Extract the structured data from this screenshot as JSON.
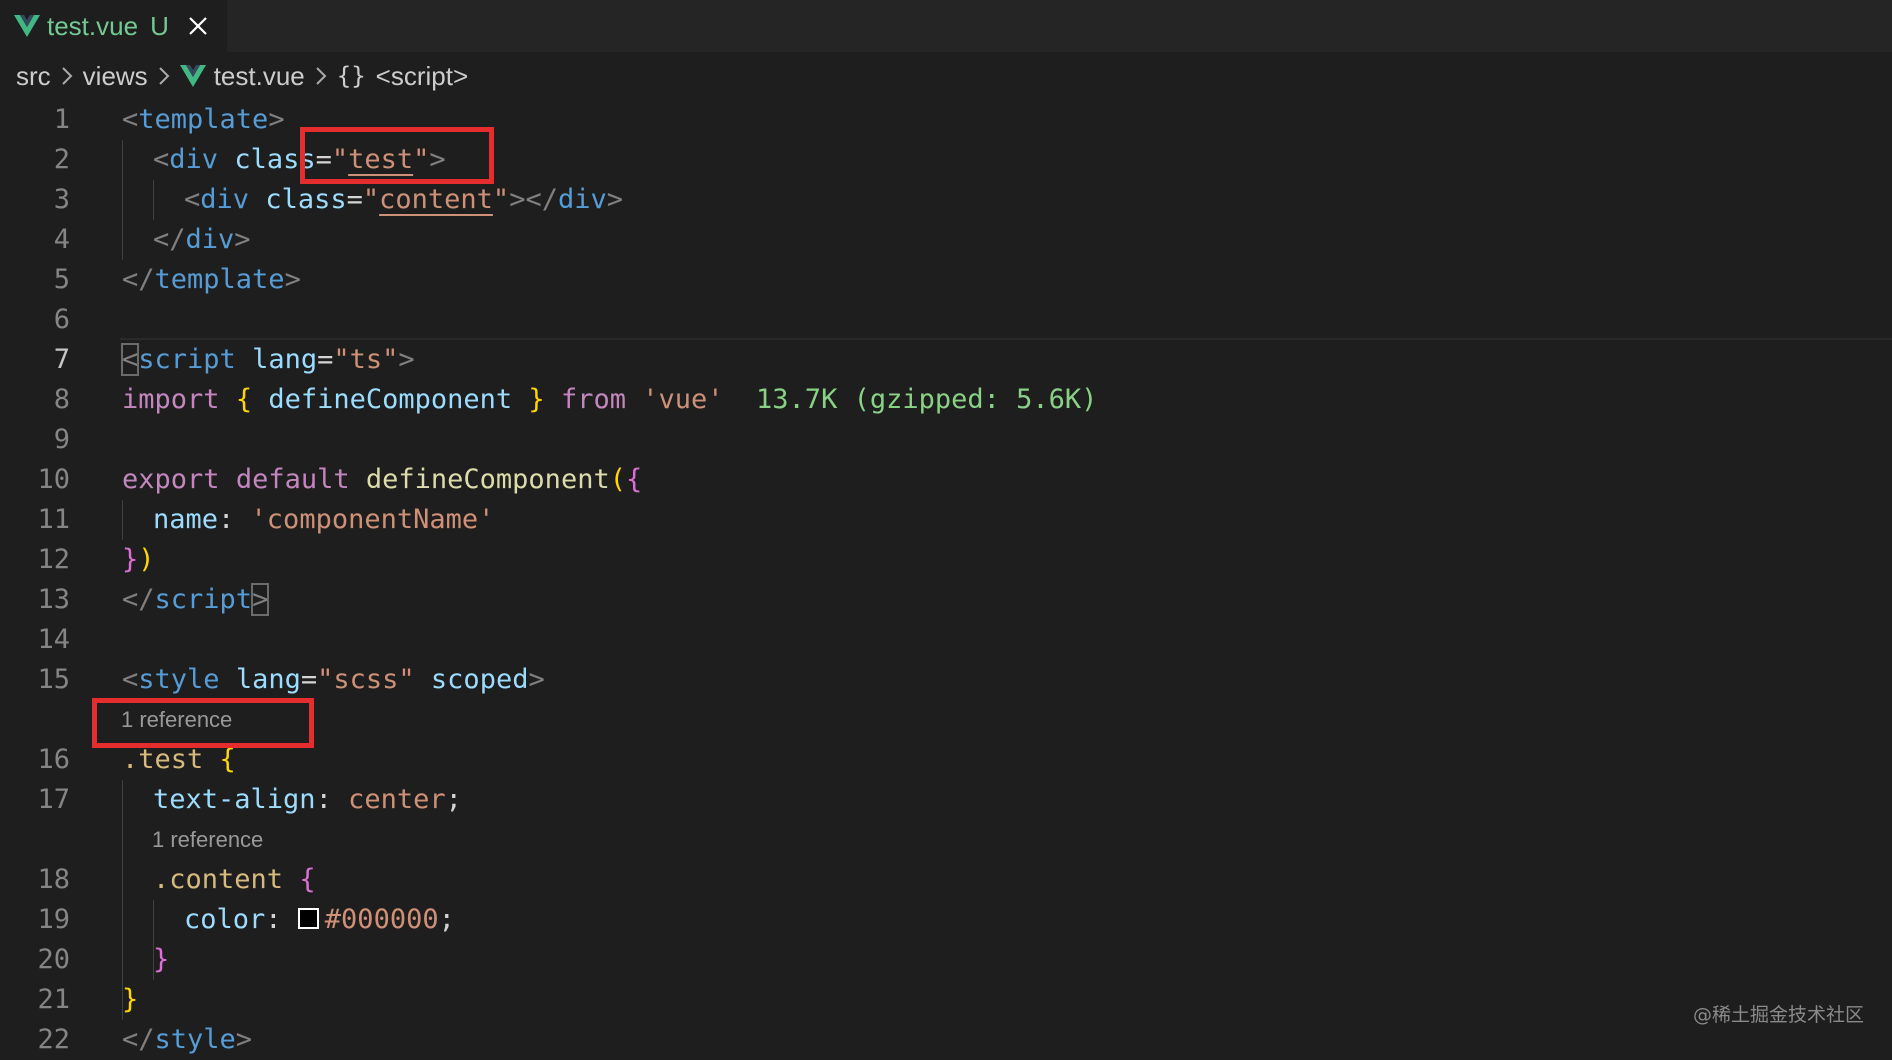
{
  "tab": {
    "file_name": "test.vue",
    "status": "U"
  },
  "breadcrumb": {
    "items": [
      "src",
      "views",
      "test.vue",
      "<script>"
    ],
    "symbol": "{}"
  },
  "editor": {
    "active_line": 7,
    "line_numbers": [
      "1",
      "2",
      "3",
      "4",
      "5",
      "6",
      "7",
      "8",
      "9",
      "10",
      "11",
      "12",
      "13",
      "14",
      "15",
      "16",
      "17",
      "18",
      "19",
      "20",
      "21",
      "22"
    ],
    "codelens": [
      "1 reference",
      "1 reference"
    ],
    "lines": [
      {
        "indent": 0,
        "tokens": [
          {
            "t": "<",
            "c": "t-punct"
          },
          {
            "t": "template",
            "c": "t-tag"
          },
          {
            "t": ">",
            "c": "t-punct"
          }
        ]
      },
      {
        "indent": 1,
        "tokens": [
          {
            "t": "<",
            "c": "t-punct"
          },
          {
            "t": "div",
            "c": "t-tag"
          },
          {
            "t": " ",
            "c": "t-plain"
          },
          {
            "t": "class",
            "c": "t-attr"
          },
          {
            "t": "=",
            "c": "t-plain"
          },
          {
            "t": "\"",
            "c": "t-str"
          },
          {
            "t": "test",
            "c": "t-str u-squig"
          },
          {
            "t": "\"",
            "c": "t-str"
          },
          {
            "t": ">",
            "c": "t-punct"
          }
        ]
      },
      {
        "indent": 2,
        "tokens": [
          {
            "t": "<",
            "c": "t-punct"
          },
          {
            "t": "div",
            "c": "t-tag"
          },
          {
            "t": " ",
            "c": "t-plain"
          },
          {
            "t": "class",
            "c": "t-attr"
          },
          {
            "t": "=",
            "c": "t-plain"
          },
          {
            "t": "\"",
            "c": "t-str"
          },
          {
            "t": "content",
            "c": "t-str u-squig"
          },
          {
            "t": "\"",
            "c": "t-str"
          },
          {
            "t": "></",
            "c": "t-punct"
          },
          {
            "t": "div",
            "c": "t-tag"
          },
          {
            "t": ">",
            "c": "t-punct"
          }
        ]
      },
      {
        "indent": 1,
        "tokens": [
          {
            "t": "</",
            "c": "t-punct"
          },
          {
            "t": "div",
            "c": "t-tag"
          },
          {
            "t": ">",
            "c": "t-punct"
          }
        ]
      },
      {
        "indent": 0,
        "tokens": [
          {
            "t": "</",
            "c": "t-punct"
          },
          {
            "t": "template",
            "c": "t-tag"
          },
          {
            "t": ">",
            "c": "t-punct"
          }
        ]
      },
      {
        "indent": 0,
        "tokens": []
      },
      {
        "indent": 0,
        "tokens": [
          {
            "t": "<",
            "c": "t-punct bracket-match"
          },
          {
            "t": "script",
            "c": "t-tag"
          },
          {
            "t": " ",
            "c": "t-plain"
          },
          {
            "t": "lang",
            "c": "t-attr"
          },
          {
            "t": "=",
            "c": "t-plain"
          },
          {
            "t": "\"ts\"",
            "c": "t-str"
          },
          {
            "t": ">",
            "c": "t-punct"
          }
        ]
      },
      {
        "indent": 0,
        "tokens": [
          {
            "t": "import",
            "c": "t-kw"
          },
          {
            "t": " ",
            "c": "t-plain"
          },
          {
            "t": "{",
            "c": "t-b1"
          },
          {
            "t": " defineComponent ",
            "c": "t-var"
          },
          {
            "t": "}",
            "c": "t-b1"
          },
          {
            "t": " ",
            "c": "t-plain"
          },
          {
            "t": "from",
            "c": "t-kw"
          },
          {
            "t": " ",
            "c": "t-plain"
          },
          {
            "t": "'vue'",
            "c": "t-str"
          },
          {
            "t": "  13.7K (gzipped: 5.6K)",
            "c": "t-hint"
          }
        ]
      },
      {
        "indent": 0,
        "tokens": []
      },
      {
        "indent": 0,
        "tokens": [
          {
            "t": "export",
            "c": "t-kw"
          },
          {
            "t": " ",
            "c": "t-plain"
          },
          {
            "t": "default",
            "c": "t-kw"
          },
          {
            "t": " ",
            "c": "t-plain"
          },
          {
            "t": "defineComponent",
            "c": "t-fn"
          },
          {
            "t": "(",
            "c": "t-b1"
          },
          {
            "t": "{",
            "c": "t-b2"
          }
        ]
      },
      {
        "indent": 1,
        "tokens": [
          {
            "t": "name",
            "c": "t-var"
          },
          {
            "t": ": ",
            "c": "t-plain"
          },
          {
            "t": "'componentName'",
            "c": "t-str"
          }
        ]
      },
      {
        "indent": 0,
        "tokens": [
          {
            "t": "}",
            "c": "t-b2"
          },
          {
            "t": ")",
            "c": "t-b1"
          }
        ]
      },
      {
        "indent": 0,
        "tokens": [
          {
            "t": "</",
            "c": "t-punct"
          },
          {
            "t": "script",
            "c": "t-tag"
          },
          {
            "t": ">",
            "c": "t-punct bracket-match"
          }
        ]
      },
      {
        "indent": 0,
        "tokens": []
      },
      {
        "indent": 0,
        "tokens": [
          {
            "t": "<",
            "c": "t-punct"
          },
          {
            "t": "style",
            "c": "t-tag"
          },
          {
            "t": " ",
            "c": "t-plain"
          },
          {
            "t": "lang",
            "c": "t-attr"
          },
          {
            "t": "=",
            "c": "t-plain"
          },
          {
            "t": "\"scss\"",
            "c": "t-str"
          },
          {
            "t": " ",
            "c": "t-plain"
          },
          {
            "t": "scoped",
            "c": "t-attr"
          },
          {
            "t": ">",
            "c": "t-punct"
          }
        ]
      },
      {
        "indent": 0,
        "tokens": [
          {
            "t": ".test",
            "c": "t-sel"
          },
          {
            "t": " ",
            "c": "t-plain"
          },
          {
            "t": "{",
            "c": "t-b1"
          }
        ]
      },
      {
        "indent": 1,
        "tokens": [
          {
            "t": "text-align",
            "c": "t-var"
          },
          {
            "t": ": ",
            "c": "t-plain"
          },
          {
            "t": "center",
            "c": "t-str"
          },
          {
            "t": ";",
            "c": "t-plain"
          }
        ]
      },
      {
        "indent": 1,
        "tokens": [
          {
            "t": ".content",
            "c": "t-sel"
          },
          {
            "t": " ",
            "c": "t-plain"
          },
          {
            "t": "{",
            "c": "t-b2"
          }
        ]
      },
      {
        "indent": 2,
        "tokens": [
          {
            "t": "color",
            "c": "t-var"
          },
          {
            "t": ": ",
            "c": "t-plain"
          },
          {
            "swatch": "#000000"
          },
          {
            "t": "#000000",
            "c": "t-str"
          },
          {
            "t": ";",
            "c": "t-plain"
          }
        ]
      },
      {
        "indent": 1,
        "tokens": [
          {
            "t": "}",
            "c": "t-b2"
          }
        ]
      },
      {
        "indent": 0,
        "tokens": [
          {
            "t": "}",
            "c": "t-b1"
          }
        ]
      },
      {
        "indent": 0,
        "tokens": [
          {
            "t": "</",
            "c": "t-punct"
          },
          {
            "t": "style",
            "c": "t-tag"
          },
          {
            "t": ">",
            "c": "t-punct"
          }
        ]
      }
    ]
  },
  "colors": {
    "annotation_box": "#e52d2d",
    "vue_logo_green": "#41b883",
    "modified_file": "#73c991"
  },
  "watermark": "@稀土掘金技术社区"
}
